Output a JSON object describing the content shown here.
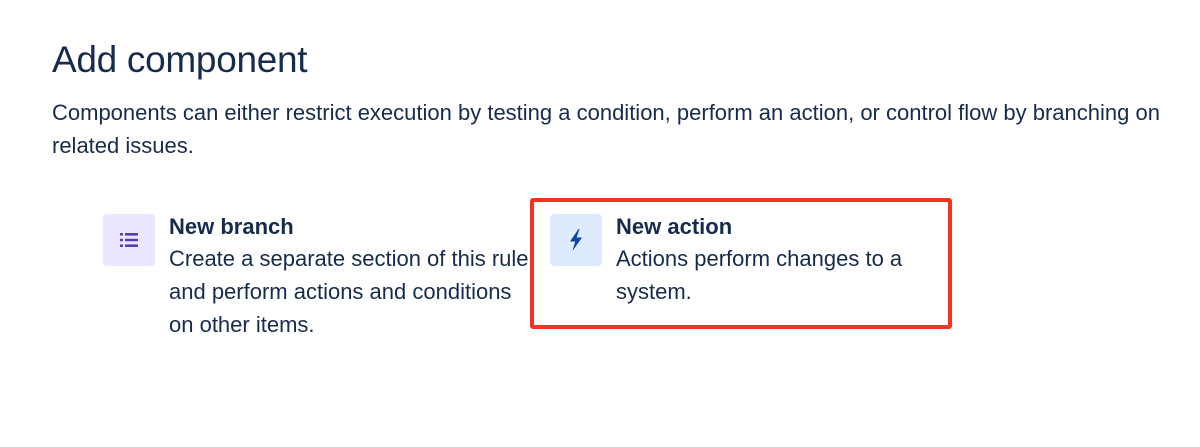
{
  "header": {
    "title": "Add component",
    "description": "Components can either restrict execution by testing a condition, perform an action, or control flow by branching on related issues."
  },
  "options": [
    {
      "title": "New branch",
      "description": "Create a separate section of this rule and perform actions and conditions on other items.",
      "icon": "list-icon",
      "icon_color": "#5243aa",
      "tile_color": "#eae6ff"
    },
    {
      "title": "New action",
      "description": "Actions perform changes to a system.",
      "icon": "lightning-bolt-icon",
      "icon_color": "#0747a6",
      "tile_color": "#deebff",
      "highlighted": true
    }
  ],
  "colors": {
    "text": "#172b4d",
    "highlight_border": "#f5331f"
  }
}
